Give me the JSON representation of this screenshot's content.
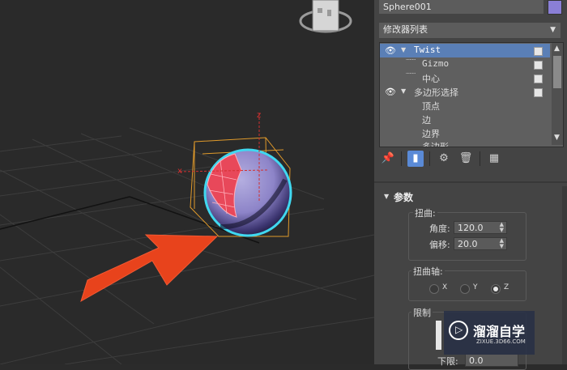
{
  "object_name": "Sphere001",
  "swatch_color": "#8a7fd6",
  "modifier_list_label": "修改器列表",
  "stack": {
    "items": [
      {
        "label": "Twist",
        "selected": true
      },
      {
        "label": "Gizmo"
      },
      {
        "label": "中心"
      },
      {
        "label": "多边形选择"
      },
      {
        "label": "顶点"
      },
      {
        "label": "边"
      },
      {
        "label": "边界"
      },
      {
        "label": "多边形"
      }
    ]
  },
  "toolbar": {
    "pin_icon": "pin-icon",
    "show_end_icon": "show-end-result-icon",
    "make_unique_icon": "make-unique-icon",
    "remove_icon": "trash-icon",
    "configure_icon": "configure-sets-icon"
  },
  "params": {
    "rollout_title": "参数",
    "twist_group": "扭曲:",
    "angle_label": "角度:",
    "angle_value": "120.0",
    "bias_label": "偏移:",
    "bias_value": "20.0",
    "axis_group": "扭曲轴:",
    "axes": [
      "X",
      "Y",
      "Z"
    ],
    "selected_axis": "Z",
    "limits_group": "限制",
    "lower_label": "下限:",
    "lower_value": "0.0"
  },
  "watermark": {
    "brand": "溜溜自学",
    "url": "ZIXUE.3D66.COM"
  },
  "colors": {
    "accent_arrow": "#e8431c",
    "selection_highlight": "#5a7fb6",
    "sphere": "#8d84c8",
    "twisted_faces": "#e8485a",
    "gizmo": "#e09a2a",
    "selection_ring": "#40d8f0"
  }
}
